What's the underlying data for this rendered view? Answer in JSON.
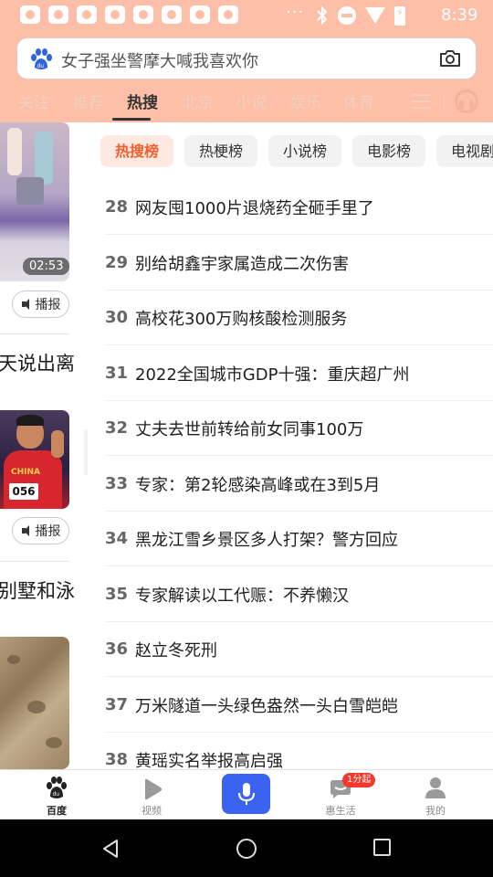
{
  "status_bar": {
    "time": "8:39",
    "more_indicator": "···"
  },
  "search": {
    "placeholder": "女子强坐警摩大喊我喜欢你"
  },
  "top_tabs": [
    "关注",
    "推荐",
    "热搜",
    "北京",
    "小说",
    "娱乐",
    "体育"
  ],
  "active_tab": "热搜",
  "left_feed": {
    "video_duration": "02:53",
    "broadcast_label": "播报",
    "partial_title_1": "天说出离",
    "partial_title_2": "别墅和泳",
    "bib_number": "056",
    "jersey_text": "CHINA"
  },
  "chips": [
    "热搜榜",
    "热梗榜",
    "小说榜",
    "电影榜",
    "电视剧"
  ],
  "active_chip": "热搜榜",
  "hot_list": [
    {
      "rank": "28",
      "title": "网友囤1000片退烧药全砸手里了"
    },
    {
      "rank": "29",
      "title": "别给胡鑫宇家属造成二次伤害"
    },
    {
      "rank": "30",
      "title": "高校花300万购核酸检测服务"
    },
    {
      "rank": "31",
      "title": "2022全国城市GDP十强：重庆超广州"
    },
    {
      "rank": "32",
      "title": "丈夫去世前转给前女同事100万"
    },
    {
      "rank": "33",
      "title": "专家：第2轮感染高峰或在3到5月"
    },
    {
      "rank": "34",
      "title": "黑龙江雪乡景区多人打架？警方回应"
    },
    {
      "rank": "35",
      "title": "专家解读以工代赈：不养懒汉"
    },
    {
      "rank": "36",
      "title": "赵立冬死刑"
    },
    {
      "rank": "37",
      "title": "万米隧道一头绿色盎然一头白雪皑皑"
    },
    {
      "rank": "38",
      "title": "黄瑶实名举报高启强"
    }
  ],
  "bottom_nav": {
    "home": "百度",
    "video": "视频",
    "life": "惠生活",
    "me": "我的",
    "life_badge": "1分起"
  },
  "colors": {
    "header_bg": "#fdbfa7",
    "accent": "#f35f2a",
    "mic_button": "#3b63f2",
    "badge": "#f2392b"
  }
}
